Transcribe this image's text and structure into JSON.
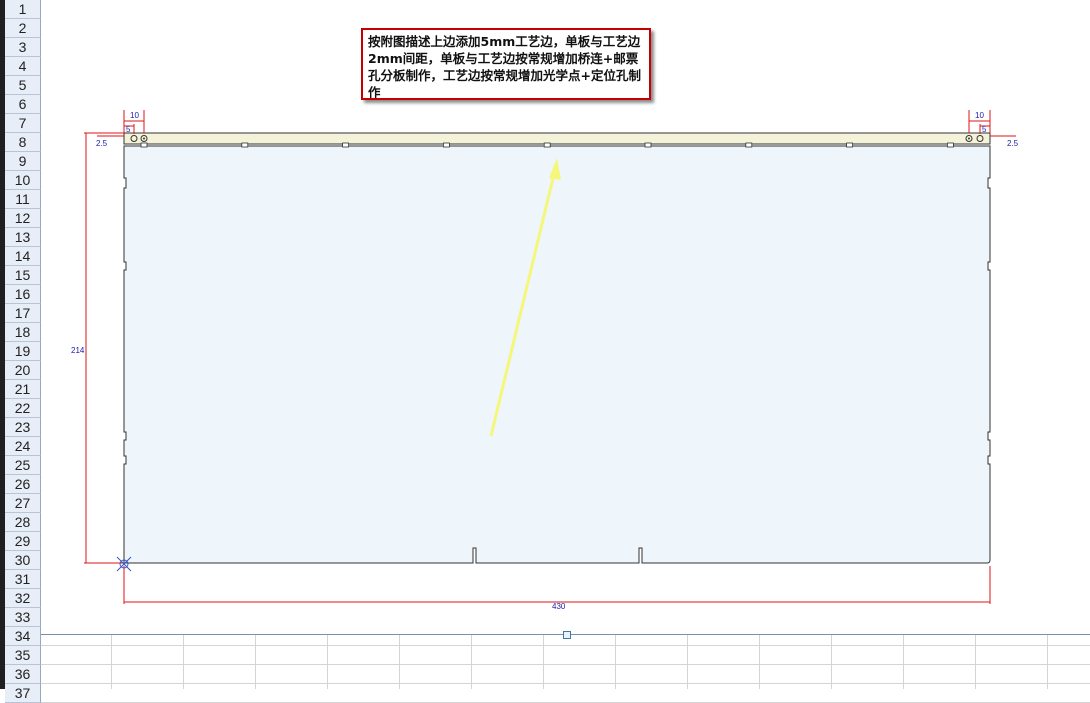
{
  "rows": [
    "1",
    "2",
    "3",
    "4",
    "5",
    "6",
    "7",
    "8",
    "9",
    "10",
    "11",
    "12",
    "13",
    "14",
    "15",
    "16",
    "17",
    "18",
    "19",
    "20",
    "21",
    "22",
    "23",
    "24",
    "25",
    "26",
    "27",
    "28",
    "29",
    "30",
    "31",
    "32",
    "33",
    "34",
    "35",
    "36",
    "37"
  ],
  "note": {
    "text": "按附图描述上边添加5mm工艺边，单板与工艺边2mm间距，单板与工艺边按常规增加桥连+邮票孔分板制作，工艺边按常规增加光学点+定位孔制作"
  },
  "dimensions": {
    "total_width": "430",
    "height": "214",
    "rail_offset_left": "2.5",
    "rail_offset_right": "2.5",
    "fiducial_spacing_left": "10",
    "hole_spacing_left": "5",
    "fiducial_spacing_right": "10",
    "hole_spacing_right": "5"
  },
  "colors": {
    "board_fill": "#eef5fb",
    "rail_fill": "#f4f2d8",
    "dimension_line": "#e01515",
    "dimension_text": "#1a1aaa",
    "arrow": "#f4f77a",
    "note_border": "#c40000"
  }
}
